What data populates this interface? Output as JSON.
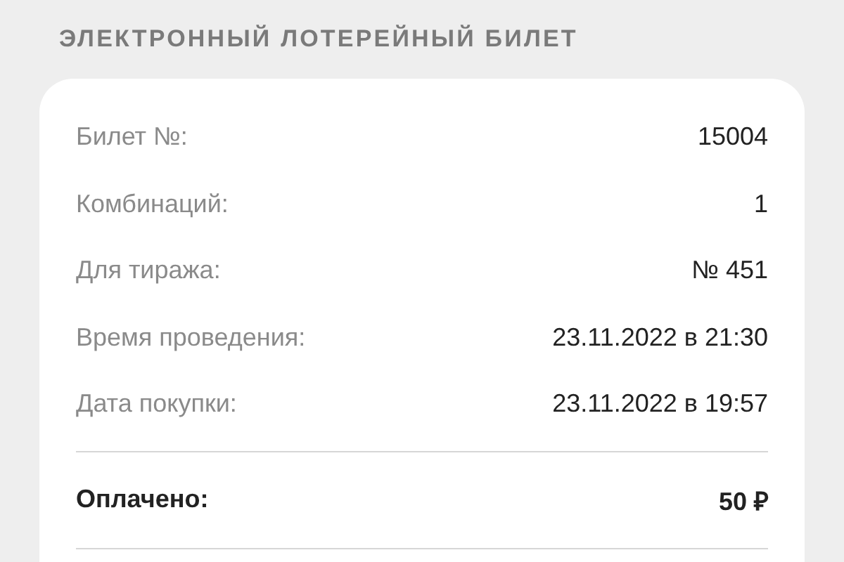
{
  "title": "ЭЛЕКТРОННЫЙ ЛОТЕРЕЙНЫЙ БИЛЕТ",
  "details": [
    {
      "label": "Билет №:",
      "value": "15004"
    },
    {
      "label": "Комбинаций:",
      "value": "1"
    },
    {
      "label": "Для тиража:",
      "value": "№ 451"
    },
    {
      "label": "Время проведения:",
      "value": "23.11.2022 в 21:30"
    },
    {
      "label": "Дата покупки:",
      "value": "23.11.2022 в 19:57"
    }
  ],
  "total": {
    "label": "Оплачено:",
    "value": "50 ₽"
  }
}
